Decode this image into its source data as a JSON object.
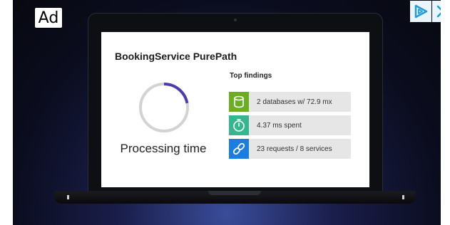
{
  "ad": {
    "badge_label": "Ad",
    "colors": {
      "background": "#0b0d1f",
      "glow": "#3a4c9a",
      "adchoice_bg": "#e9f4fb",
      "adchoice_icon": "#1e9bd7"
    }
  },
  "laptop_screen": {
    "title": "BookingService PurePath",
    "processing": {
      "label": "Processing time",
      "progress_fraction": 0.22,
      "colors": {
        "track": "#d3d3d3",
        "progress": "#4b3ea8"
      }
    },
    "findings": {
      "heading": "Top findings",
      "items": [
        {
          "text": "2 databases w/ 72.9 mx",
          "icon": "database-icon",
          "color": "#6cad26"
        },
        {
          "text": "4.37 ms spent",
          "icon": "stopwatch-icon",
          "color": "#36b68e"
        },
        {
          "text": "23 requests / 8 services",
          "icon": "link-icon",
          "color": "#1a7ee0"
        }
      ]
    }
  }
}
